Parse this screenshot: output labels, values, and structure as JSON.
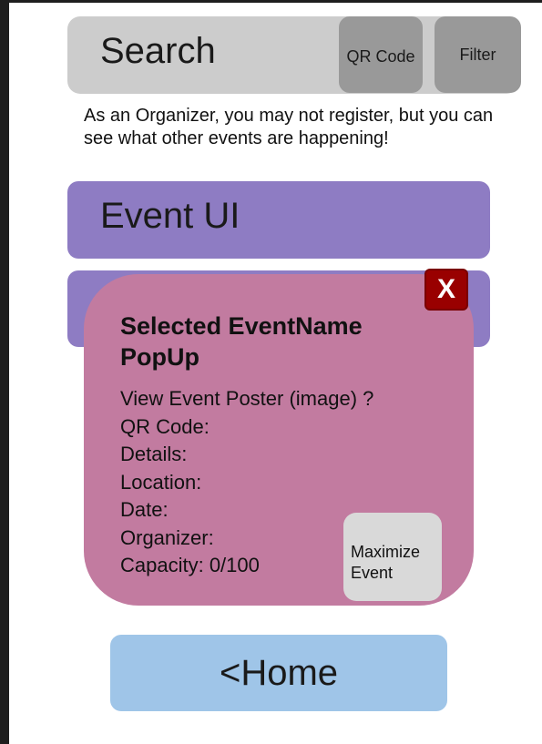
{
  "search": {
    "label": "Search",
    "qr_button": "QR Code",
    "filter_button": "Filter"
  },
  "notice": "As an Organizer, you may not register, but you can see what other events are happening!",
  "events": [
    {
      "label": "Event UI"
    }
  ],
  "popup": {
    "close_label": "X",
    "title": "Selected EventName PopUp",
    "lines": [
      "View Event Poster (image) ?",
      "QR Code:",
      "Details:",
      "Location:",
      "Date:",
      "Organizer:",
      "Capacity: 0/100"
    ],
    "maximize_button": "Maximize Event"
  },
  "home_button": "<Home",
  "colors": {
    "search_bar": "#cccccc",
    "buttons": "#999999",
    "event_card": "#8e7cc3",
    "popup": "#c27ba0",
    "close": "#990000",
    "home": "#9fc5e8"
  }
}
